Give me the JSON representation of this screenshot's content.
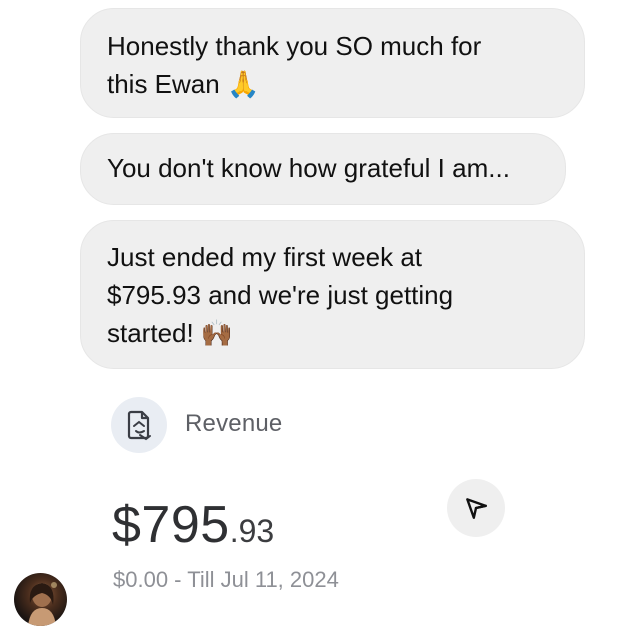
{
  "messages": [
    {
      "lines": [
        "Honestly thank you SO much for",
        "this Ewan 🙏"
      ]
    },
    {
      "lines": [
        "You don't know how grateful I am..."
      ]
    },
    {
      "lines": [
        "Just ended my first week at",
        "$795.93 and we're just getting",
        "started! 🙌🏾"
      ]
    }
  ],
  "revenue_card": {
    "icon": "revenue-document-icon",
    "label": "Revenue",
    "amount_main": "$795",
    "amount_cents": ".93",
    "subline": "$0.00 - Till Jul 11, 2024"
  },
  "actions": {
    "share_icon": "paper-plane-icon"
  },
  "sender": {
    "avatar": "profile-photo"
  },
  "colors": {
    "bubble_bg": "#efefef",
    "icon_circle_bg": "#e9edf3",
    "muted_text": "#8e9096"
  }
}
